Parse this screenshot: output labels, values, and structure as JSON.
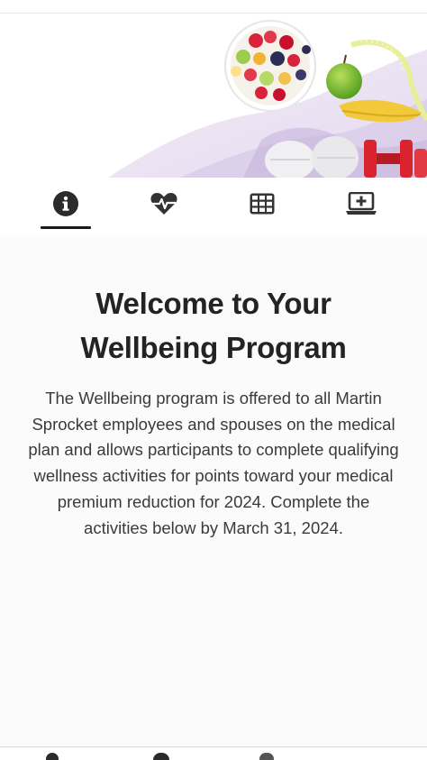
{
  "hero": {
    "image_name": "healthy-lifestyle-banner"
  },
  "tabs": [
    {
      "icon": "info-icon",
      "active": true
    },
    {
      "icon": "heart-pulse-icon",
      "active": false
    },
    {
      "icon": "grid-table-icon",
      "active": false
    },
    {
      "icon": "laptop-plus-icon",
      "active": false
    }
  ],
  "welcome": {
    "title_line1": "Welcome to Your",
    "title_line2": "Wellbeing Program",
    "body": "The Wellbeing program is offered to all Martin Sprocket employees and spouses on the medical plan and allows participants to complete qualifying wellness activities for points toward your medical premium reduction for 2024. Complete the activities below by March 31, 2024."
  },
  "colors": {
    "text_dark": "#232323",
    "body_text": "#3a3a3a",
    "icon": "#333333",
    "accent_active": "#1a1a1a"
  }
}
